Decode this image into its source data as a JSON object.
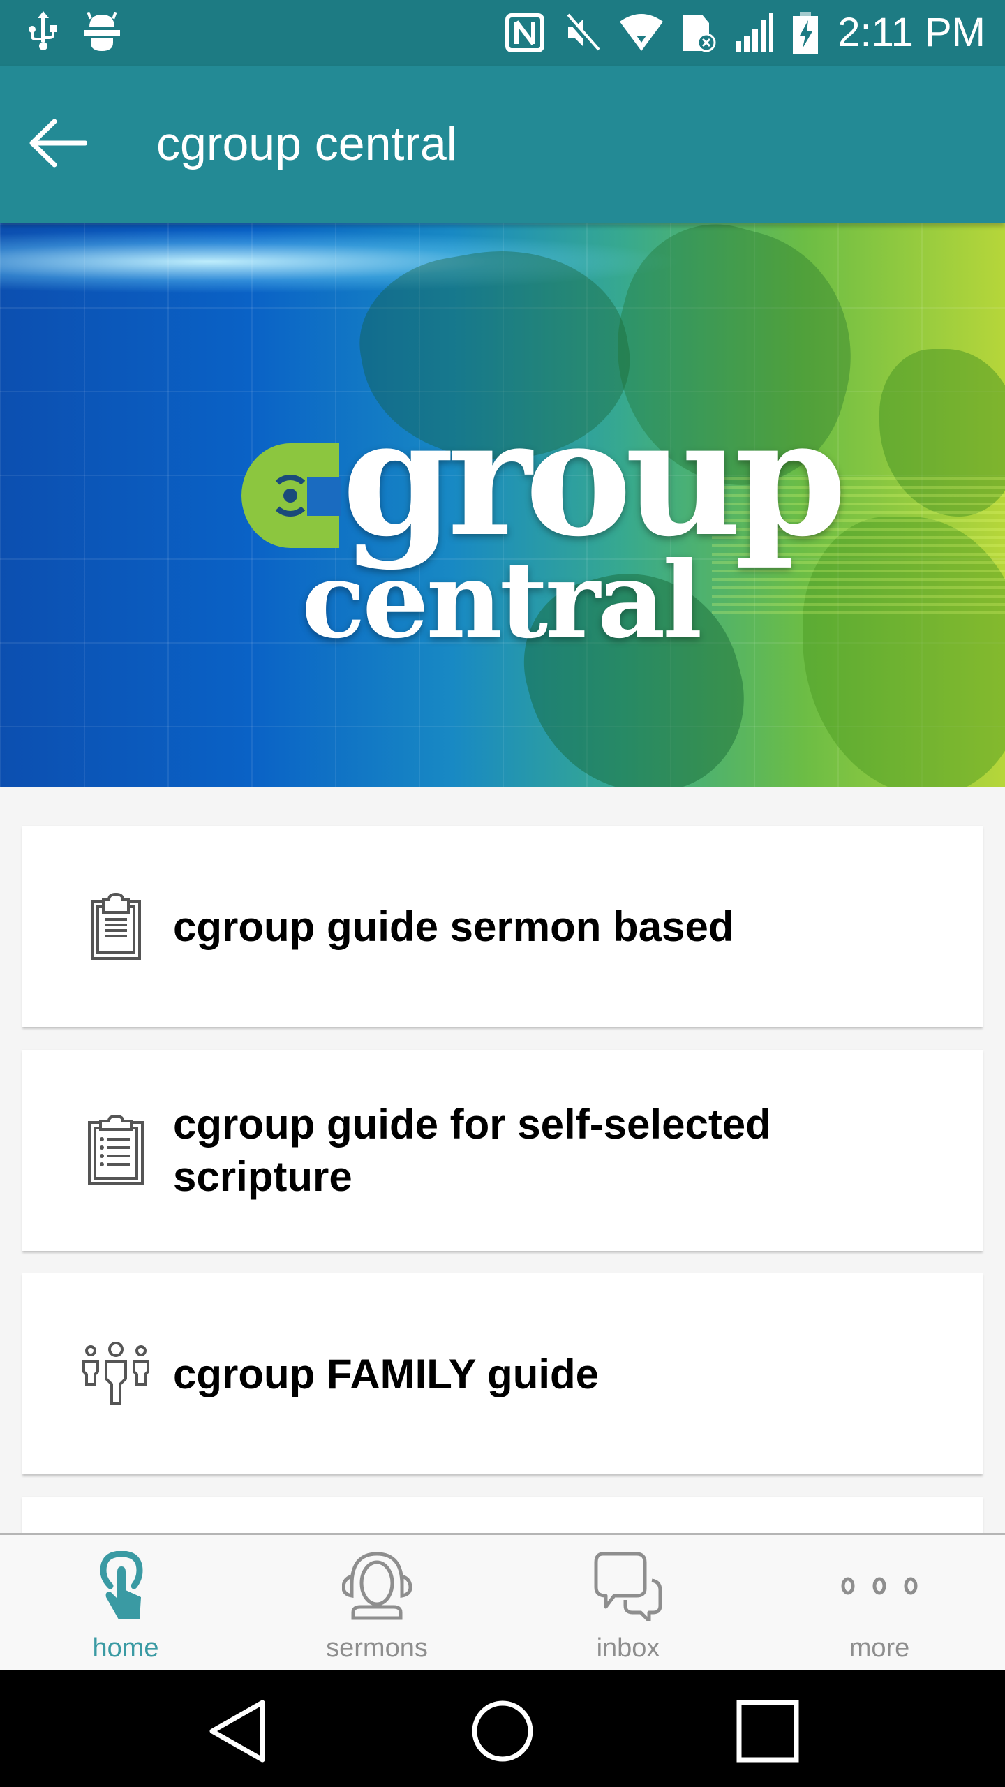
{
  "status_bar": {
    "time": "2:11 PM",
    "left_icons": [
      "usb-icon",
      "android-debug-icon"
    ],
    "right_icons": [
      "nfc-icon",
      "mute-icon",
      "wifi-icon",
      "sim-no-service-icon",
      "signal-icon",
      "battery-charging-icon"
    ]
  },
  "app_bar": {
    "back_icon": "arrow-left-icon",
    "title": "cgroup central"
  },
  "banner": {
    "logo_line1": "group",
    "logo_line2": "central",
    "logo_mark": "c"
  },
  "colors": {
    "status_bar": "#1d7b83",
    "app_bar": "#238a95",
    "accent": "#3a9aa3",
    "logo_green": "#8cc63f",
    "inactive": "#8e8e8e"
  },
  "list": {
    "items": [
      {
        "icon": "clipboard-icon",
        "label": "cgroup guide sermon based"
      },
      {
        "icon": "clipboard-list-icon",
        "label": "cgroup guide for self-selected scripture"
      },
      {
        "icon": "family-icon",
        "label": "cgroup FAMILY guide"
      },
      {
        "icon": "",
        "label": ""
      }
    ]
  },
  "bottom_nav": {
    "items": [
      {
        "icon": "tap-icon",
        "label": "home",
        "active": true
      },
      {
        "icon": "headset-icon",
        "label": "sermons",
        "active": false
      },
      {
        "icon": "chat-bubbles-icon",
        "label": "inbox",
        "active": false
      },
      {
        "icon": "more-dots-icon",
        "label": "more",
        "active": false
      }
    ]
  },
  "system_nav": {
    "buttons": [
      "back",
      "home",
      "recents"
    ]
  }
}
